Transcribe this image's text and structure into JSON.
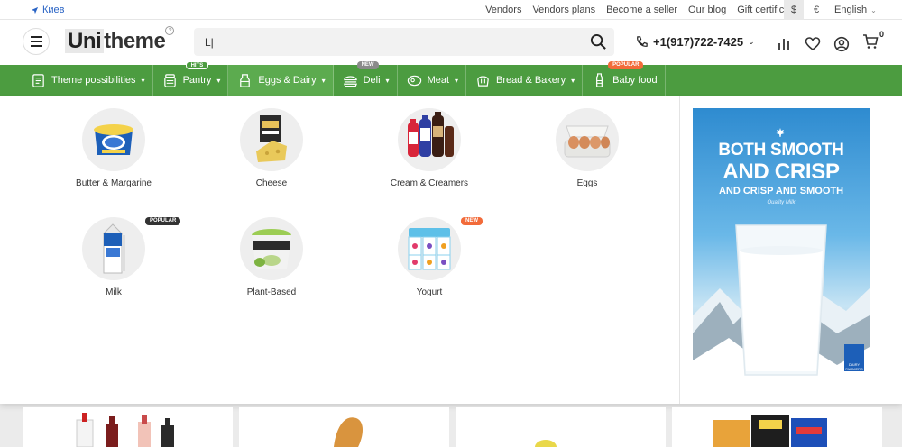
{
  "topbar": {
    "location": "Киев",
    "links": [
      "Vendors",
      "Vendors plans",
      "Become a seller",
      "Our blog",
      "Gift certificates"
    ],
    "currencies": [
      "$",
      "€"
    ],
    "language": "English"
  },
  "header": {
    "logo_u": "Uni",
    "logo_rest": "theme",
    "search_value": "L|",
    "phone": "+1(917)722-7425",
    "cart_count": "0"
  },
  "nav": [
    {
      "label": "Theme possibilities",
      "icon": "checklist-icon",
      "tag": ""
    },
    {
      "label": "Pantry",
      "icon": "jar-icon",
      "tag": "HITS"
    },
    {
      "label": "Eggs & Dairy",
      "icon": "milk-bottle-icon",
      "tag": ""
    },
    {
      "label": "Deli",
      "icon": "burger-icon",
      "tag": "NEW"
    },
    {
      "label": "Meat",
      "icon": "steak-icon",
      "tag": ""
    },
    {
      "label": "Bread & Bakery",
      "icon": "bread-icon",
      "tag": ""
    },
    {
      "label": "Baby food",
      "icon": "baby-bottle-icon",
      "tag": "POPULAR"
    }
  ],
  "categories": [
    {
      "label": "Butter & Margarine",
      "badge": ""
    },
    {
      "label": "Cheese",
      "badge": ""
    },
    {
      "label": "Cream & Creamers",
      "badge": ""
    },
    {
      "label": "Eggs",
      "badge": ""
    },
    {
      "label": "Milk",
      "badge": "POPULAR"
    },
    {
      "label": "Plant-Based",
      "badge": ""
    },
    {
      "label": "Yogurt",
      "badge": "NEW"
    }
  ],
  "promo": {
    "line1": "BOTH SMOOTH",
    "line2": "AND CRISP",
    "line3": "AND CRISP AND SMOOTH",
    "line4": "Quality Milk",
    "brand": "DAIRY FARMERS"
  }
}
